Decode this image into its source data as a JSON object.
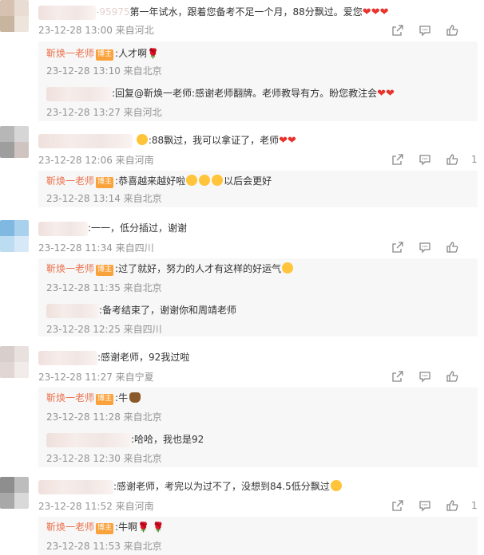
{
  "colors": {
    "accent_name": "#eb7350",
    "meta_gray": "#939393",
    "reply_bg": "#f7f7f7",
    "badge": "#f9a23b"
  },
  "icons": [
    "share-icon",
    "comment-icon",
    "like-icon"
  ],
  "comments": [
    {
      "text_prefix": "-95975",
      "text": "第一年试水，跟着您备考不足一个月，88分飘过。爱您",
      "meta": "23-12-28 13:00 来自河北",
      "likes": "",
      "replies": [
        {
          "name": "靳焕一老师",
          "badge": "博主",
          "text": ":人才啊",
          "meta": "23-12-28 13:10 来自北京"
        },
        {
          "name": "",
          "badge": "",
          "text": ":回复@靳焕一老师:感谢老师翻牌。老师教导有方。盼您教注会",
          "meta": "23-12-28 13:27 来自河北"
        }
      ]
    },
    {
      "text": ":88飘过，我可以拿证了，老师",
      "meta": "23-12-28 12:06 来自河南",
      "likes": "1",
      "replies": [
        {
          "name": "靳焕一老师",
          "badge": "博主",
          "text": ":恭喜越来越好啦",
          "text_after": "以后会更好",
          "meta": "23-12-28 13:14 来自北京"
        }
      ]
    },
    {
      "text": ":一一，低分插过，谢谢",
      "meta": "23-12-28 11:34 来自四川",
      "likes": "",
      "replies": [
        {
          "name": "靳焕一老师",
          "badge": "博主",
          "text": ":过了就好，努力的人才有这样的好运气",
          "meta": "23-12-28 11:35 来自北京"
        },
        {
          "name": "",
          "badge": "",
          "text": ":备考结束了，谢谢你和周靖老师",
          "meta": "23-12-28 12:25 来自四川"
        }
      ]
    },
    {
      "text": ":感谢老师，92我过啦",
      "meta": "23-12-28 11:27 来自宁夏",
      "likes": "",
      "replies": [
        {
          "name": "靳焕一老师",
          "badge": "博主",
          "text": ":牛",
          "meta": "23-12-28 11:28 来自北京"
        },
        {
          "name": "",
          "badge": "",
          "text": ":哈哈，我也是92",
          "meta": "23-12-28 12:30 来自北京"
        }
      ]
    },
    {
      "text": ":感谢老师，考完以为过不了，没想到84.5低分飘过",
      "meta": "23-12-28 11:52 来自河南",
      "likes": "1",
      "replies": [
        {
          "name": "靳焕一老师",
          "badge": "博主",
          "text": ":牛啊",
          "meta": "23-12-28 11:53 来自北京"
        }
      ]
    }
  ]
}
